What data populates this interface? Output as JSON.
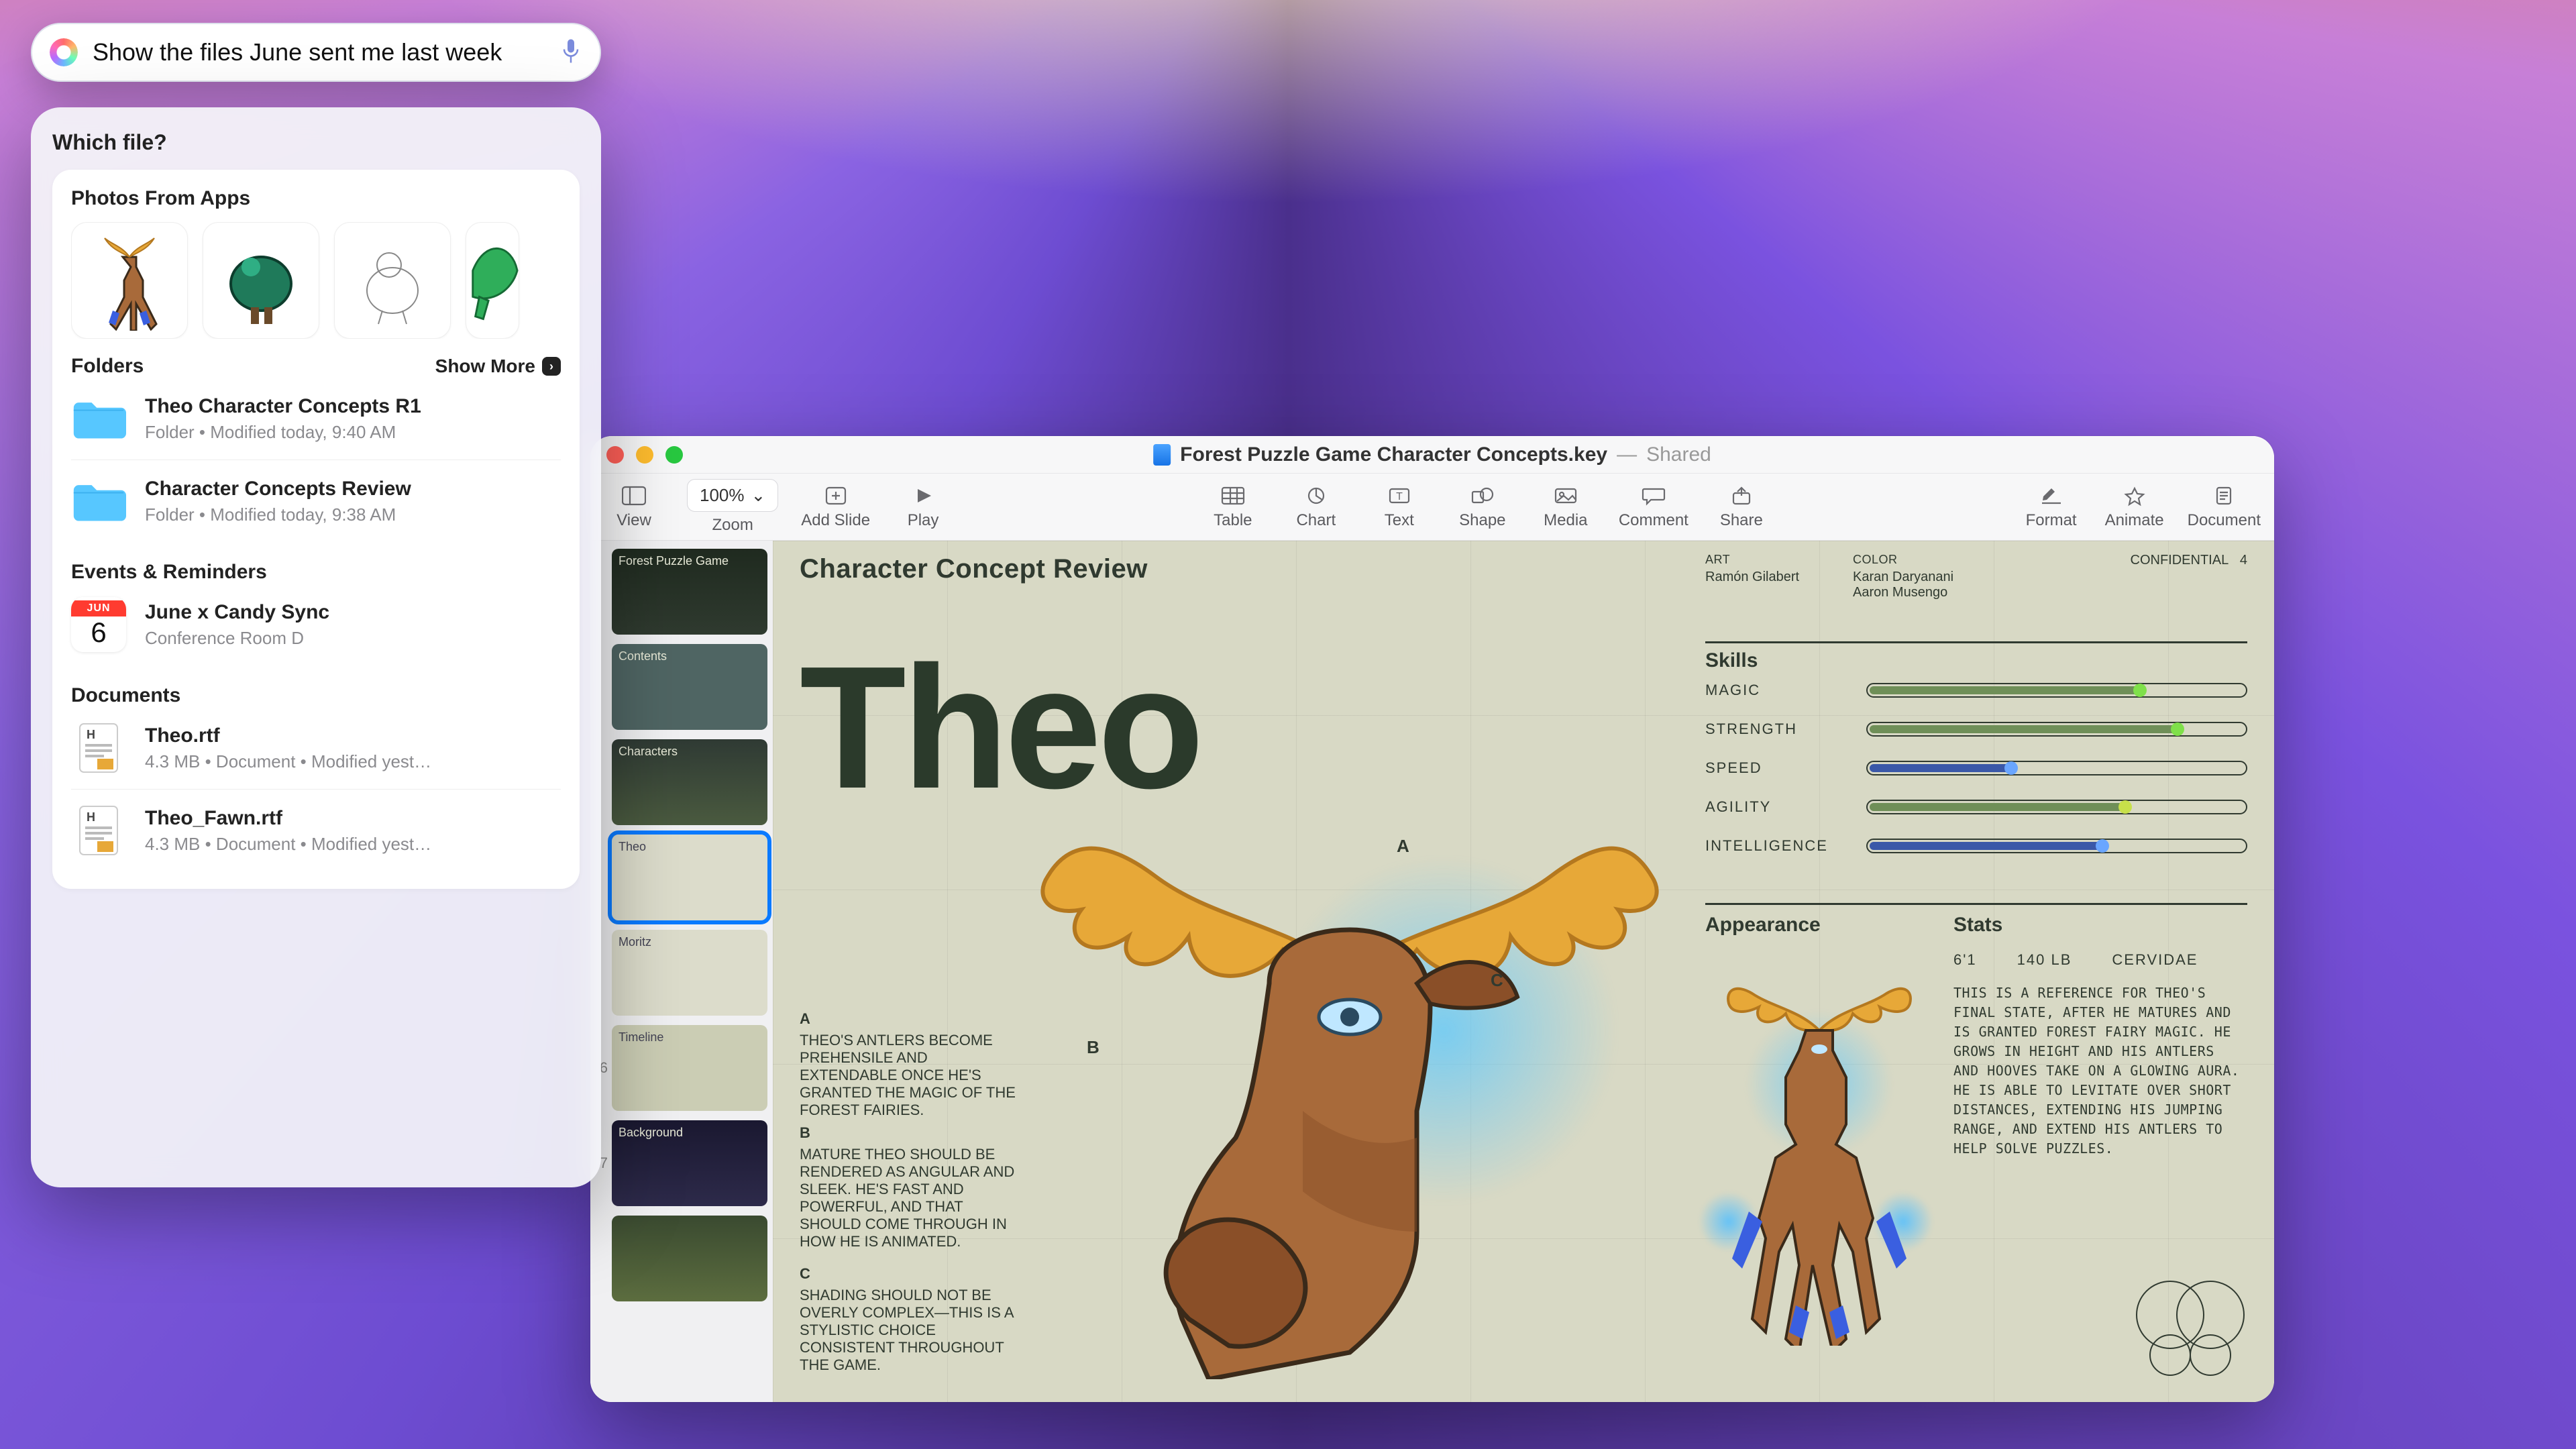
{
  "search": {
    "value": "Show the files June sent me last week"
  },
  "spotlight": {
    "prompt": "Which file?",
    "sections": {
      "photos_label": "Photos From Apps",
      "folders_label": "Folders",
      "show_more": "Show More",
      "events_label": "Events & Reminders",
      "documents_label": "Documents"
    },
    "folders": [
      {
        "title": "Theo Character Concepts R1",
        "sub": "Folder • Modified today, 9:40 AM"
      },
      {
        "title": "Character Concepts Review",
        "sub": "Folder • Modified today, 9:38 AM"
      }
    ],
    "event": {
      "month": "JUN",
      "day": "6",
      "title": "June x Candy Sync",
      "sub": "Conference Room D"
    },
    "documents": [
      {
        "title": "Theo.rtf",
        "sub": "4.3 MB • Document • Modified yest…"
      },
      {
        "title": "Theo_Fawn.rtf",
        "sub": "4.3 MB • Document • Modified yest…"
      }
    ]
  },
  "keynote": {
    "doc_title": "Forest Puzzle Game Character Concepts.key",
    "dash": "—",
    "shared": "Shared",
    "toolbar": {
      "view": "View",
      "zoom": "Zoom",
      "add_slide": "Add Slide",
      "play": "Play",
      "table": "Table",
      "chart": "Chart",
      "text": "Text",
      "shape": "Shape",
      "media": "Media",
      "comment": "Comment",
      "share": "Share",
      "format": "Format",
      "animate": "Animate",
      "document": "Document",
      "zoom_value": "100%"
    },
    "thumbs": [
      {
        "n": "",
        "label": "Forest Puzzle Game"
      },
      {
        "n": "",
        "label": "Contents"
      },
      {
        "n": "",
        "label": "Characters"
      },
      {
        "n": "",
        "label": "Theo"
      },
      {
        "n": "",
        "label": "Moritz"
      },
      {
        "n": "6",
        "label": "Timeline"
      },
      {
        "n": "7",
        "label": "Background"
      },
      {
        "n": "",
        "label": ""
      }
    ],
    "slide": {
      "header": "Character Concept Review",
      "meta": {
        "art_label": "ART",
        "art_name": "Ramón Gilabert",
        "color_label": "COLOR",
        "color_name1": "Karan Daryanani",
        "color_name2": "Aaron Musengo",
        "conf": "CONFIDENTIAL",
        "page": "4"
      },
      "big_name": "Theo",
      "skills_label": "Skills",
      "skills": [
        {
          "name": "MAGIC",
          "pct": 72,
          "fill": "#6f8f58",
          "knob": "#7fe04a"
        },
        {
          "name": "STRENGTH",
          "pct": 82,
          "fill": "#6f8f58",
          "knob": "#7fe04a"
        },
        {
          "name": "SPEED",
          "pct": 38,
          "fill": "#3a58a8",
          "knob": "#6aa6ff"
        },
        {
          "name": "AGILITY",
          "pct": 68,
          "fill": "#6f8f58",
          "knob": "#c7e04a"
        },
        {
          "name": "INTELLIGENCE",
          "pct": 62,
          "fill": "#3a58a8",
          "knob": "#6aa6ff"
        }
      ],
      "appearance_label": "Appearance",
      "stats_label": "Stats",
      "stats_line": {
        "height": "6'1",
        "weight": "140 LB",
        "species": "CERVIDAE"
      },
      "stats_body": "THIS IS A REFERENCE FOR THEO'S FINAL STATE, AFTER HE MATURES AND IS GRANTED FOREST FAIRY MAGIC. HE GROWS IN HEIGHT AND HIS ANTLERS AND HOOVES TAKE ON A GLOWING AURA. HE IS ABLE TO LEVITATE OVER SHORT DISTANCES, EXTENDING HIS JUMPING RANGE, AND EXTEND HIS ANTLERS TO HELP SOLVE PUZZLES.",
      "annot": {
        "a_mark": "A",
        "b_mark": "B",
        "c_mark": "C",
        "a_lead": "A",
        "a_text": "THEO'S ANTLERS BECOME PREHENSILE AND EXTENDABLE ONCE HE'S GRANTED THE MAGIC OF THE FOREST FAIRIES.",
        "b_lead": "B",
        "b_text": "MATURE THEO SHOULD BE RENDERED AS ANGULAR AND SLEEK. HE'S FAST AND POWERFUL, AND THAT SHOULD COME THROUGH IN HOW HE IS ANIMATED.",
        "c_lead": "C",
        "c_text": "SHADING SHOULD NOT BE OVERLY COMPLEX—THIS IS A STYLISTIC CHOICE CONSISTENT THROUGHOUT THE GAME."
      }
    }
  }
}
